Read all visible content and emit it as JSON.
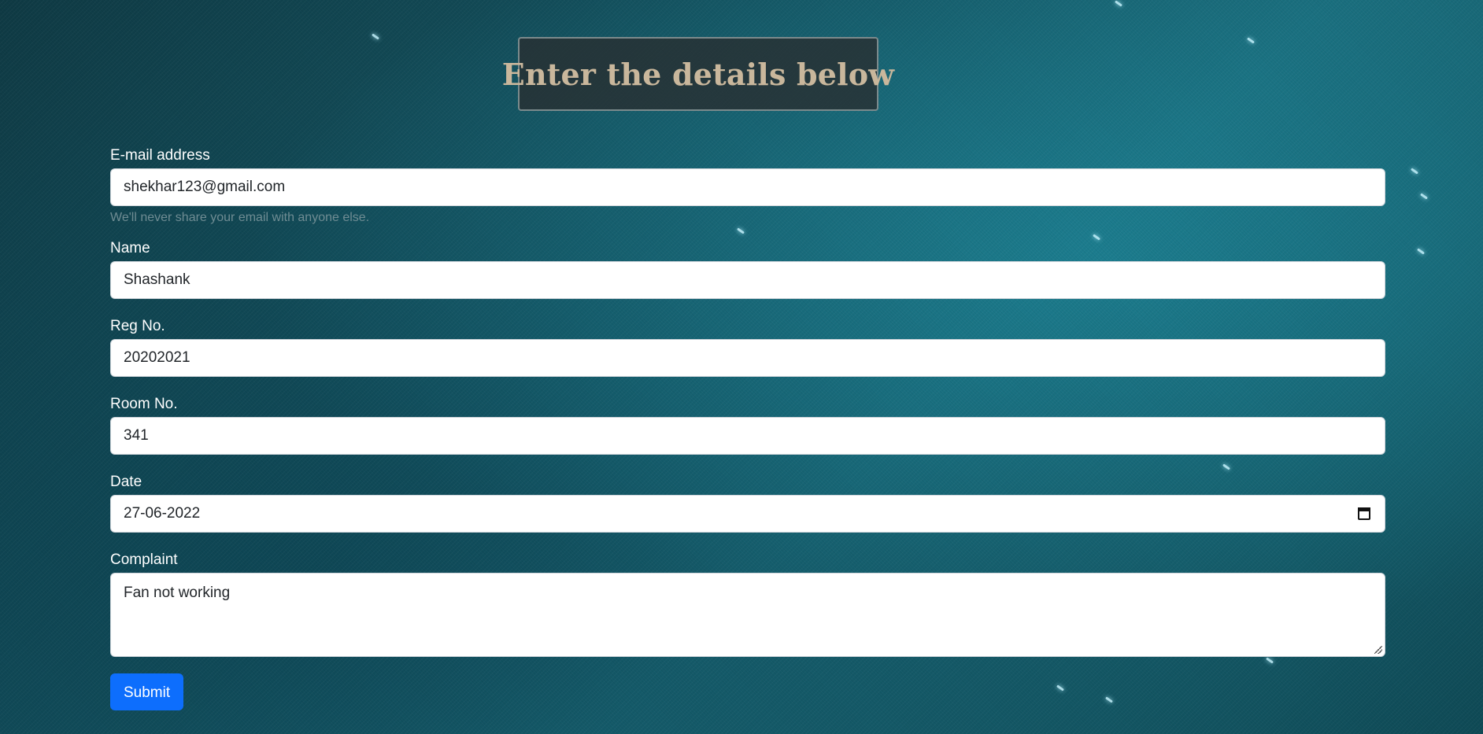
{
  "heading": "Enter the details below",
  "form": {
    "email": {
      "label": "E-mail address",
      "value": "shekhar123@gmail.com",
      "hint": "We'll never share your email with anyone else."
    },
    "name": {
      "label": "Name",
      "value": "Shashank"
    },
    "reg_no": {
      "label": "Reg No.",
      "value": "20202021"
    },
    "room_no": {
      "label": "Room No.",
      "value": "341"
    },
    "date": {
      "label": "Date",
      "value": "27-06-2022",
      "icon": "calendar-icon"
    },
    "complaint": {
      "label": "Complaint",
      "value": "Fan not working"
    },
    "submit_label": "Submit"
  },
  "colors": {
    "background": "#155765",
    "heading_text": "#c9b79c",
    "primary_button": "#0d6efd"
  }
}
